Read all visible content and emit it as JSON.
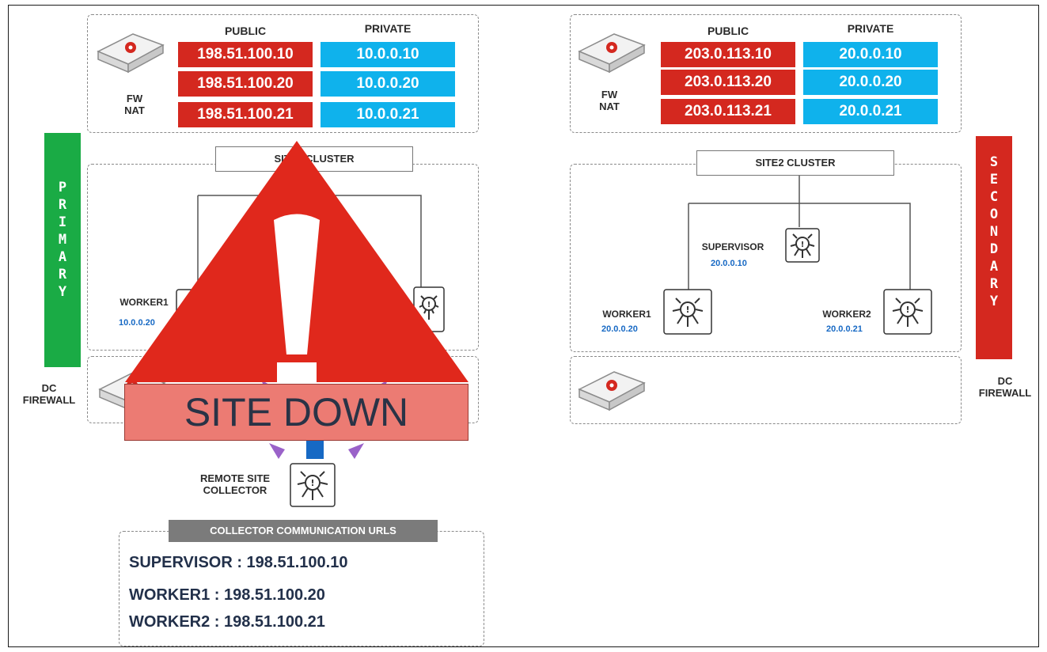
{
  "site1": {
    "nat": {
      "public_header": "PUBLIC",
      "private_header": "PRIVATE",
      "device_label_1": "FW",
      "device_label_2": "NAT",
      "rows": [
        {
          "public": "198.51.100.10",
          "private": "10.0.0.10"
        },
        {
          "public": "198.51.100.20",
          "private": "10.0.0.20"
        },
        {
          "public": "198.51.100.21",
          "private": "10.0.0.21"
        }
      ]
    },
    "cluster_title": "SITE1 CLUSTER",
    "worker1": {
      "label": "WORKER1",
      "ip": "10.0.0.20"
    },
    "banner": "PRIMARY",
    "dc_label_1": "DC",
    "dc_label_2": "FIREWALL"
  },
  "site2": {
    "nat": {
      "public_header": "PUBLIC",
      "private_header": "PRIVATE",
      "device_label_1": "FW",
      "device_label_2": "NAT",
      "rows": [
        {
          "public": "203.0.113.10",
          "private": "20.0.0.10"
        },
        {
          "public": "203.0.113.20",
          "private": "20.0.0.20"
        },
        {
          "public": "203.0.113.21",
          "private": "20.0.0.21"
        }
      ]
    },
    "cluster_title": "SITE2 CLUSTER",
    "supervisor": {
      "label": "SUPERVISOR",
      "ip": "20.0.0.10"
    },
    "worker1": {
      "label": "WORKER1",
      "ip": "20.0.0.20"
    },
    "worker2": {
      "label": "WORKER2",
      "ip": "20.0.0.21"
    },
    "banner": "SECONDARY",
    "dc_label_1": "DC",
    "dc_label_2": "FIREWALL"
  },
  "collector": {
    "label_1": "REMOTE SITE",
    "label_2": "COLLECTOR",
    "urls_title": "COLLECTOR COMMUNICATION URLS",
    "urls": [
      "SUPERVISOR : 198.51.100.10",
      "WORKER1 : 198.51.100.20",
      "WORKER2 : 198.51.100.21"
    ]
  },
  "alert": {
    "text": "SITE DOWN"
  },
  "colors": {
    "public_red": "#d4281f",
    "private_blue": "#0fb2ec",
    "primary_green": "#1aab45",
    "secondary_red": "#d4281f",
    "alert_red": "#e0281c",
    "alert_banner": "#ec7b73"
  }
}
